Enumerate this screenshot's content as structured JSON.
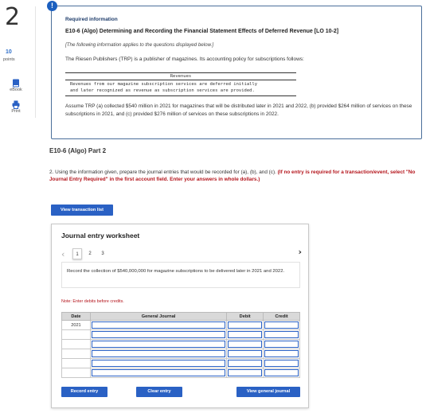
{
  "question": {
    "number": "2",
    "points_value": "10",
    "points_label": "points",
    "tools": [
      {
        "label": "eBook",
        "icon": "book-icon"
      },
      {
        "label": "Print",
        "icon": "printer-icon"
      }
    ]
  },
  "info": {
    "badge": "!",
    "heading": "Required information",
    "problem_title": "E10-6 (Algo) Determining and Recording the Financial Statement Effects of Deferred Revenue [LO 10-2]",
    "italic_note": "[The following information applies to the questions displayed below.]",
    "intro": "The Riesen Publishers (TRP) is a publisher of magazines. Its accounting policy for subscriptions follows:",
    "policy_header": "Revenues",
    "policy_lines": [
      "Revenues from our magazine subscription services are deferred initially",
      "and later recognized as revenue as subscription services are provided."
    ],
    "assume_text": "Assume TRP (a) collected $540 million in 2021 for magazines that will be distributed later in 2021 and 2022, (b) provided $264 million of services on these subscriptions in 2021, and (c) provided $276 million of services on these subscriptions in 2022."
  },
  "part": {
    "title": "E10-6 (Algo) Part 2",
    "instruction": "2. Using the information given, prepare the journal entries that would be recorded for (a), (b), and (c).",
    "instruction_red": "(If no entry is required for a transaction/event, select \"No Journal Entry Required\" in the first account field. Enter your answers in whole dollars.)"
  },
  "buttons": {
    "view_transaction_list": "View transaction list",
    "record_entry": "Record entry",
    "clear_entry": "Clear entry",
    "view_general_journal": "View general journal"
  },
  "worksheet": {
    "title": "Journal entry worksheet",
    "pages": [
      "1",
      "2",
      "3"
    ],
    "active_page": "1",
    "task": "Record the collection of $540,000,000 for magazine subscriptions to be delivered later in 2021 and 2022.",
    "note": "Note: Enter debits before credits.",
    "columns": {
      "date": "Date",
      "account": "General Journal",
      "debit": "Debit",
      "credit": "Credit"
    },
    "rows": [
      {
        "date": "2021"
      },
      {
        "date": ""
      },
      {
        "date": ""
      },
      {
        "date": ""
      },
      {
        "date": ""
      },
      {
        "date": ""
      }
    ]
  }
}
